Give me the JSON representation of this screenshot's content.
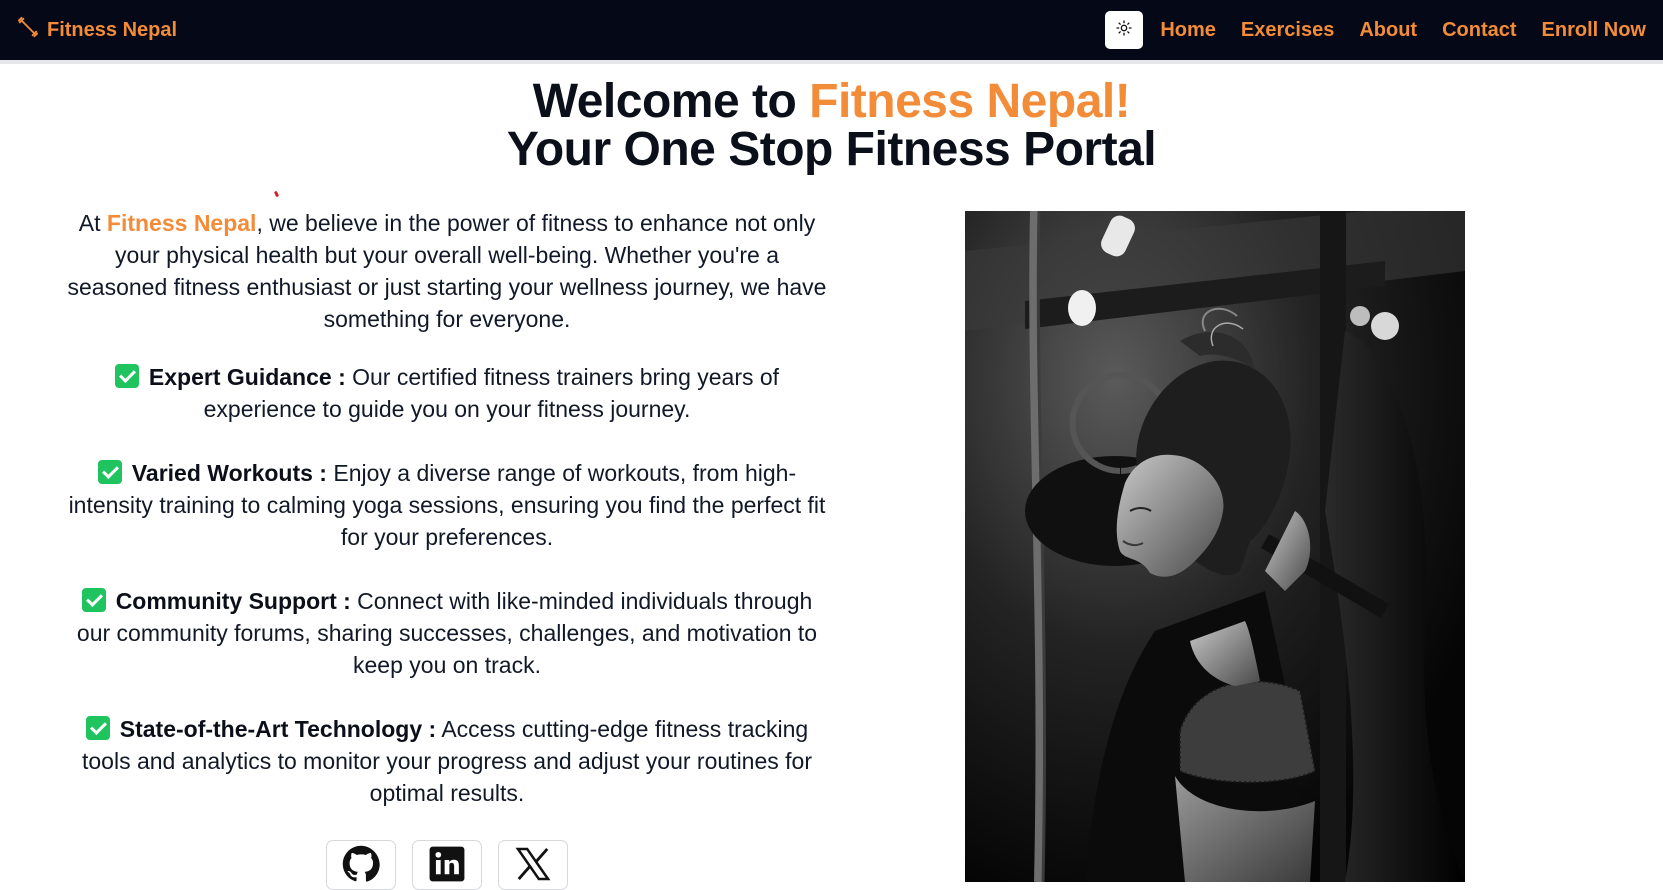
{
  "navbar": {
    "brand": "Fitness Nepal",
    "links": [
      "Home",
      "Exercises",
      "About",
      "Contact",
      "Enroll Now"
    ]
  },
  "hero": {
    "title_prefix": "Welcome to ",
    "title_accent": "Fitness Nepal!",
    "title_line2": "Your One Stop Fitness Portal"
  },
  "intro": {
    "prefix": "At ",
    "accent": "Fitness Nepal",
    "text": ", we believe in the power of fitness to enhance not only your physical health but your overall well-being. Whether you're a seasoned fitness enthusiast or just starting your wellness journey, we have something for everyone."
  },
  "features": [
    {
      "title": "Expert Guidance :",
      "text": " Our certified fitness trainers bring years of experience to guide you on your fitness journey."
    },
    {
      "title": "Varied Workouts :",
      "text": " Enjoy a diverse range of workouts, from high-intensity training to calming yoga sessions, ensuring you find the perfect fit for your preferences."
    },
    {
      "title": "Community Support :",
      "text": " Connect with like-minded individuals through our community forums, sharing successes, challenges, and motivation to keep you on track."
    },
    {
      "title": "State-of-the-Art Technology :",
      "text": " Access cutting-edge fitness tracking tools and analytics to monitor your progress and adjust your routines for optimal results."
    }
  ],
  "colors": {
    "accent": "#f28c38",
    "navbar_bg": "#050816",
    "check_green": "#1fc45f"
  },
  "icons": {
    "brand": "dumbbell-icon",
    "theme": "sun-icon",
    "socials": [
      "github-icon",
      "linkedin-icon",
      "x-icon"
    ]
  }
}
